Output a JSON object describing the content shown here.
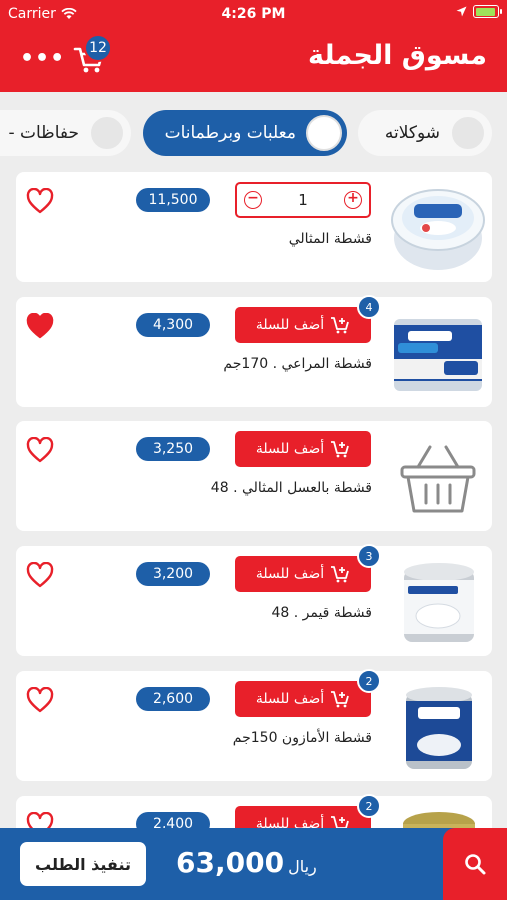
{
  "status_bar": {
    "carrier": "Carrier",
    "time": "4:26 PM"
  },
  "header": {
    "title": "مسوق الجملة",
    "cart_count": "12",
    "menu_icon": "more-icon"
  },
  "categories": [
    {
      "label": "شوكلاته",
      "selected": false
    },
    {
      "label": "معلبات وبرطمانات",
      "selected": true
    },
    {
      "label": "حفاظات -",
      "selected": false
    }
  ],
  "products": [
    {
      "name": "قشطة المثالي",
      "price": "11,500",
      "favorite": false,
      "quantity": "1",
      "in_cart": true,
      "image": "cream-tub-almithali"
    },
    {
      "name": "قشطة المراعي . 170جم",
      "price": "4,300",
      "favorite": true,
      "add_label": "أضف للسلة",
      "cart_qty": "4",
      "image": "almarai-cream-can"
    },
    {
      "name": "قشطة بالعسل المثالي . 48",
      "price": "3,250",
      "favorite": false,
      "add_label": "أضف للسلة",
      "image": "basket-placeholder"
    },
    {
      "name": "قشطة قيمر . 48",
      "price": "3,200",
      "favorite": false,
      "add_label": "أضف للسلة",
      "cart_qty": "3",
      "image": "qaimar-cream-can"
    },
    {
      "name": "قشطة الأمازون 150جم",
      "price": "2,600",
      "favorite": false,
      "add_label": "أضف للسلة",
      "cart_qty": "2",
      "image": "amazon-cream-can"
    },
    {
      "price": "2,400",
      "favorite": false,
      "add_label": "أضف للسلة",
      "cart_qty": "2",
      "image": "cream-can-partial"
    }
  ],
  "footer": {
    "checkout_label": "تنفيذ الطلب",
    "total": "63,000",
    "currency": "ريال"
  },
  "colors": {
    "brand_red": "#e8202a",
    "brand_blue": "#1e5fa8",
    "background": "#ededed"
  }
}
